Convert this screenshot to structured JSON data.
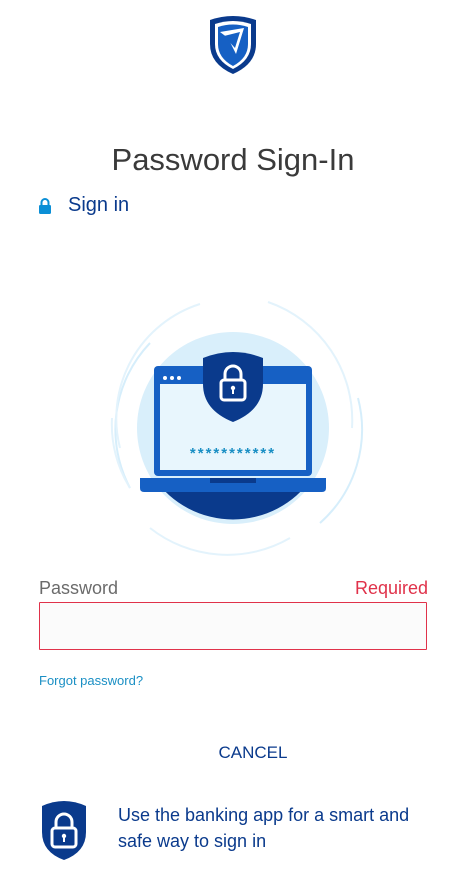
{
  "header": {
    "logo_icon": "standard-bank-shield-logo"
  },
  "page": {
    "title": "Password Sign-In",
    "signin_label": "Sign in",
    "signin_icon": "lock-icon"
  },
  "illustration": {
    "masked_password": "***********",
    "icons": [
      "laptop-icon",
      "shield-lock-icon"
    ]
  },
  "form": {
    "password_label": "Password",
    "required_text": "Required",
    "password_value": "",
    "forgot_label": "Forgot password?",
    "cancel_label": "CANCEL"
  },
  "promo": {
    "icon": "shield-lock-icon",
    "text": "Use the banking app for a smart and safe way to sign in"
  },
  "colors": {
    "brand_blue": "#0a3a8c",
    "error_red": "#e0324a",
    "link_blue": "#1a8fc4",
    "light_blue": "#d6eefb"
  }
}
